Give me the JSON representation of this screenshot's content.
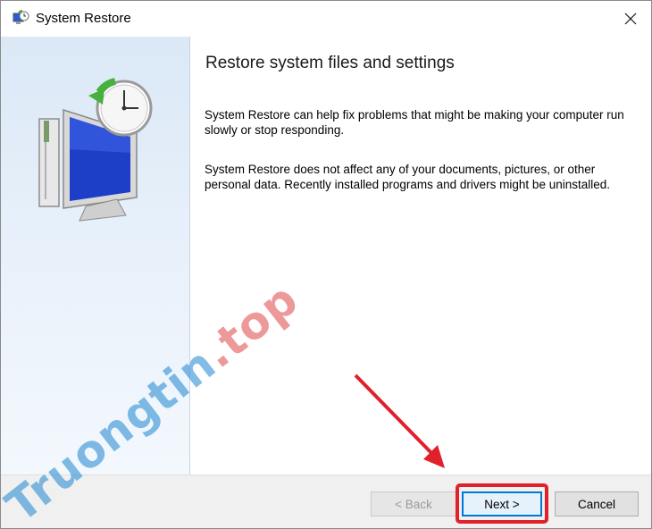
{
  "window": {
    "title": "System Restore",
    "close_icon": "close-icon",
    "app_icon": "system-restore-icon"
  },
  "main": {
    "heading": "Restore system files and settings",
    "paragraph1": "System Restore can help fix problems that might be making your computer run slowly or stop responding.",
    "paragraph2": "System Restore does not affect any of your documents, pictures, or other personal data. Recently installed programs and drivers might be uninstalled."
  },
  "footer": {
    "back_label": "< Back",
    "next_label": "Next >",
    "cancel_label": "Cancel",
    "back_enabled": false
  },
  "annotation": {
    "highlight_color": "#e0202a"
  },
  "watermark": {
    "part1": "Truongtin",
    "part2": ".top"
  }
}
